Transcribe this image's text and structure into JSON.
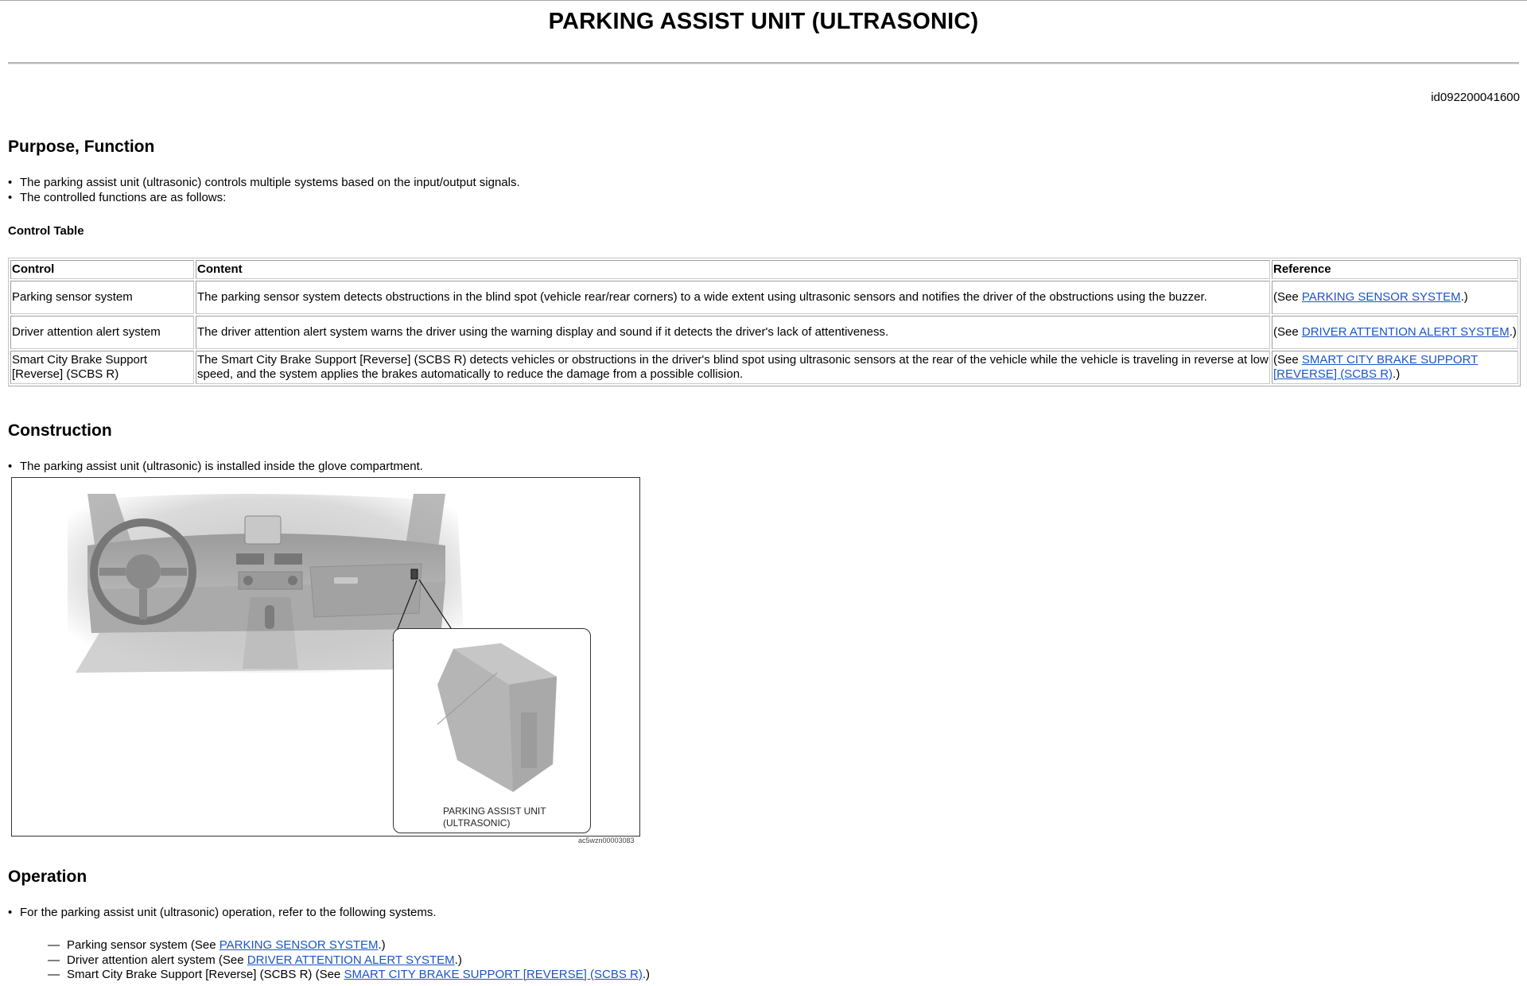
{
  "header": {
    "title": "PARKING ASSIST UNIT (ULTRASONIC)",
    "doc_id": "id092200041600"
  },
  "purpose": {
    "heading": "Purpose, Function",
    "bullets": [
      "The parking assist unit (ultrasonic) controls multiple systems based on the input/output signals.",
      "The controlled functions are as follows:"
    ],
    "table_title": "Control Table",
    "table": {
      "headers": [
        "Control",
        "Content",
        "Reference"
      ],
      "rows": [
        {
          "control": "Parking sensor system",
          "content": "The parking sensor system detects obstructions in the blind spot (vehicle rear/rear corners) to a wide extent using ultrasonic sensors and notifies the driver of the obstructions using the buzzer.",
          "ref_prefix": "(See ",
          "ref_link": "PARKING SENSOR SYSTEM",
          "ref_suffix": ".)"
        },
        {
          "control": "Driver attention alert system",
          "content": "The driver attention alert system warns the driver using the warning display and sound if it detects the driver's lack of attentiveness.",
          "ref_prefix": "(See ",
          "ref_link": "DRIVER ATTENTION ALERT SYSTEM",
          "ref_suffix": ".)"
        },
        {
          "control": "Smart City Brake Support [Reverse] (SCBS R)",
          "content": "The Smart City Brake Support [Reverse] (SCBS R) detects vehicles or obstructions in the driver's blind spot using ultrasonic sensors at the rear of the vehicle while the vehicle is traveling in reverse at low speed, and the system applies the brakes automatically to reduce the damage from a possible collision.",
          "ref_prefix": "(See ",
          "ref_link": "SMART CITY BRAKE SUPPORT [REVERSE] (SCBS R)",
          "ref_suffix": ".)"
        }
      ]
    }
  },
  "construction": {
    "heading": "Construction",
    "bullets": [
      "The parking assist unit (ultrasonic) is installed inside the glove compartment."
    ],
    "figure": {
      "callout_label_line1": "PARKING ASSIST UNIT",
      "callout_label_line2": "(ULTRASONIC)",
      "figure_id": "ac5wzn00003083"
    }
  },
  "operation": {
    "heading": "Operation",
    "bullets": [
      "For the parking assist unit (ultrasonic) operation, refer to the following systems."
    ],
    "items": [
      {
        "prefix": "Parking sensor system (See ",
        "link": "PARKING SENSOR SYSTEM",
        "suffix": ".)"
      },
      {
        "prefix": "Driver attention alert system (See ",
        "link": "DRIVER ATTENTION ALERT SYSTEM",
        "suffix": ".)"
      },
      {
        "prefix": "Smart City Brake Support [Reverse] (SCBS R) (See ",
        "link": "SMART CITY BRAKE SUPPORT [REVERSE] (SCBS R)",
        "suffix": ".)"
      }
    ]
  },
  "colors": {
    "link": "#1a56c4",
    "rule": "#b8b8b8"
  }
}
